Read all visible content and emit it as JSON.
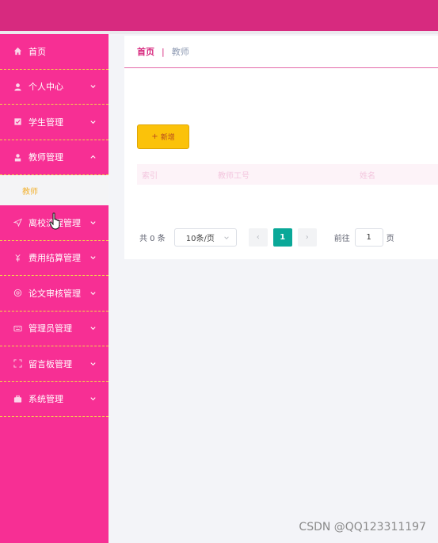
{
  "sidebar": {
    "items": [
      {
        "label": "首页",
        "icon": "home-icon"
      },
      {
        "label": "个人中心",
        "icon": "user-icon"
      },
      {
        "label": "学生管理",
        "icon": "student-icon"
      },
      {
        "label": "教师管理",
        "icon": "teacher-icon"
      },
      {
        "label": "离校流程管理",
        "icon": "send-icon"
      },
      {
        "label": "费用结算管理",
        "icon": "money-icon"
      },
      {
        "label": "论文审核管理",
        "icon": "paper-icon"
      },
      {
        "label": "管理员管理",
        "icon": "admin-icon"
      },
      {
        "label": "留言板管理",
        "icon": "message-icon"
      },
      {
        "label": "系统管理",
        "icon": "system-icon"
      }
    ],
    "submenu": {
      "label": "教师"
    }
  },
  "breadcrumb": {
    "home": "首页",
    "separator": "|",
    "current": "教师"
  },
  "toolbar": {
    "add_label": "新增",
    "add_icon": "+"
  },
  "table": {
    "headers": [
      "索引",
      "教师工号",
      "姓名"
    ]
  },
  "pagination": {
    "total": "共 0 条",
    "page_size": "10条/页",
    "current_page": "1",
    "goto_label": "前往",
    "goto_value": "1",
    "page_unit": "页",
    "prev_icon": "‹",
    "next_icon": "›"
  },
  "watermark": "CSDN @QQ123311197",
  "colors": {
    "topbar": "#d72a7f",
    "sidebar": "#f72f94",
    "add_button": "#fbc20a",
    "active_page": "#0aa898"
  }
}
